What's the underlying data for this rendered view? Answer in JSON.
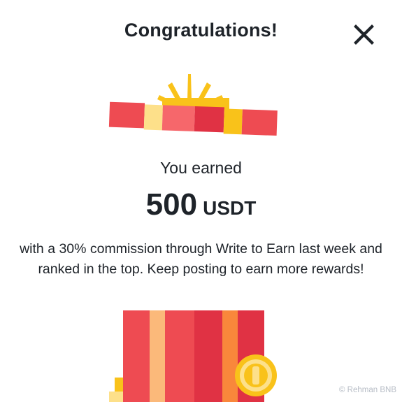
{
  "dialog": {
    "title": "Congratulations!",
    "close_icon": "close-icon",
    "earned_label": "You earned",
    "amount_value": "500",
    "amount_currency": "USDT",
    "description": "with a 30% commission through Write to Earn last week and ranked in the top. Keep posting to earn more rewards!"
  },
  "illustration": {
    "lid_icon": "gift-lid-with-bow-icon",
    "box_icon": "gift-box-icon",
    "coin_icon": "coin-icon"
  },
  "watermark": {
    "text": "© Rehman BNB"
  },
  "colors": {
    "text": "#1e2329",
    "red": "#ee4b52",
    "deep_red": "#e03244",
    "salmon": "#f6676b",
    "peach": "#fbb97a",
    "light_yellow": "#fde08a",
    "orange": "#f9873b",
    "gold": "#f9c21a",
    "watermark": "#b7bdc6"
  }
}
